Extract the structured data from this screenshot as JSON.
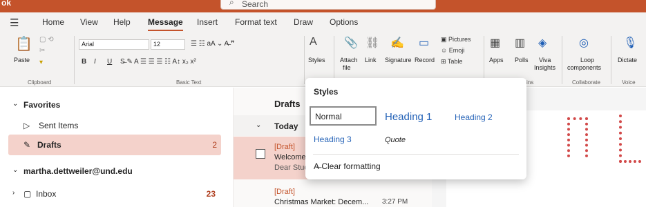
{
  "app": {
    "name": "ok",
    "accent": "#c4532b"
  },
  "search": {
    "placeholder": "Search"
  },
  "menu": {
    "tabs": [
      "Home",
      "View",
      "Help",
      "Message",
      "Insert",
      "Format text",
      "Draw",
      "Options"
    ]
  },
  "ribbon": {
    "font_name": "Arial",
    "font_size": "12",
    "paste": "Paste",
    "clipboard_label": "Clipboard",
    "basic_text_label": "Basic Text",
    "styles": "Styles",
    "attach": "Attach",
    "file": "file",
    "link": "Link",
    "signature": "Signature",
    "record": "Record",
    "pictures": "Pictures",
    "emoji": "Emoji",
    "table": "Table",
    "apps": "Apps",
    "polls": "Polls",
    "viva": "Viva",
    "insights": "Insights",
    "ins_label": "ins",
    "loop": "Loop",
    "components": "components",
    "collaborate_label": "Collaborate",
    "dictate": "Dictate",
    "voice_label": "Voice"
  },
  "nav": {
    "favorites": "Favorites",
    "sent": "Sent Items",
    "drafts": "Drafts",
    "drafts_count": "2",
    "account": "martha.dettweiler@und.edu",
    "inbox": "Inbox",
    "inbox_count": "23"
  },
  "list": {
    "header": "Drafts",
    "group": "Today",
    "items": [
      {
        "tag": "[Draft]",
        "subject": "Welcome",
        "preview": "Dear Stud"
      },
      {
        "tag": "[Draft]",
        "subject": "Christmas Market: Decem...",
        "time": "3:27 PM"
      }
    ]
  },
  "styles_popup": {
    "title": "Styles",
    "normal": "Normal",
    "heading1": "Heading 1",
    "heading2": "Heading 2",
    "heading3": "Heading 3",
    "quote": "Quote",
    "clear": "Clear formatting"
  }
}
